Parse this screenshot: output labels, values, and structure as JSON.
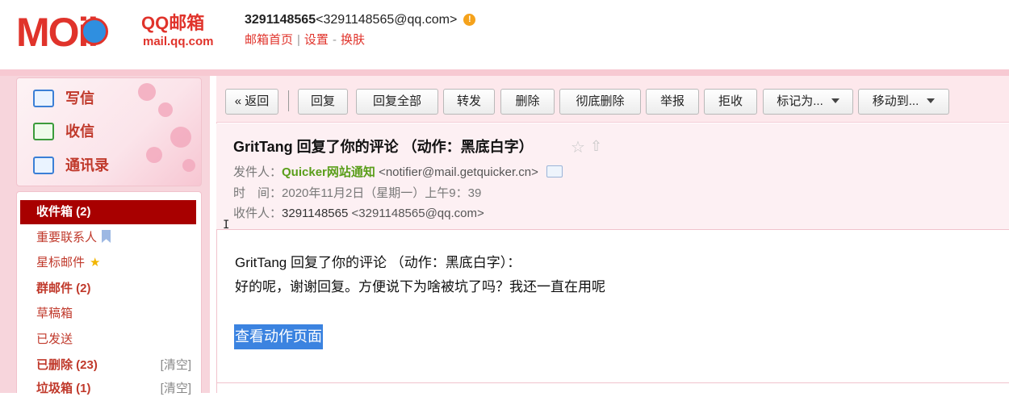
{
  "header": {
    "logo_main": "MOil",
    "logo_qq": "QQ邮箱",
    "logo_domain": "mail.qq.com",
    "user_name": "3291148565",
    "user_email": "<3291148565@qq.com>",
    "warn_glyph": "!",
    "links": [
      "邮箱首页",
      "设置",
      "换肤"
    ],
    "link_separators": [
      "|",
      "-"
    ]
  },
  "quick_actions": [
    {
      "label": "写信",
      "icon": "compose-icon"
    },
    {
      "label": "收信",
      "icon": "inbox-download-icon"
    },
    {
      "label": "通讯录",
      "icon": "contacts-icon"
    }
  ],
  "folders": [
    {
      "label": "收件箱 (2)",
      "active": true,
      "bold": true
    },
    {
      "label": "重要联系人",
      "icon": "bookmark-icon"
    },
    {
      "label": "星标邮件",
      "icon": "star-icon",
      "glyph": "★"
    },
    {
      "label": "群邮件 (2)",
      "bold": true
    },
    {
      "label": "草稿箱"
    },
    {
      "label": "已发送"
    },
    {
      "label": "已删除 (23)",
      "bold": true,
      "clear": "[清空]"
    },
    {
      "label": "垃圾箱 (1)",
      "bold": true,
      "clear": "[清空]"
    }
  ],
  "toolbar": {
    "back": "« 返回",
    "reply": "回复",
    "reply_all": "回复全部",
    "forward": "转发",
    "delete": "删除",
    "delete_permanent": "彻底删除",
    "report": "举报",
    "reject": "拒收",
    "mark_as": "标记为...",
    "move_to": "移动到..."
  },
  "mail": {
    "subject": "GritTang 回复了你的评论 （动作：黑底白字）",
    "star_glyph": "☆",
    "share_glyph": "⇧",
    "from_label": "发件人：",
    "from_name": "Quicker网站通知",
    "from_addr": "<notifier@mail.getquicker.cn>",
    "time_label": "时　间：",
    "time_value": "2020年11月2日（星期一）上午9：39",
    "to_label": "收件人：",
    "to_name": "3291148565",
    "to_addr": "<3291148565@qq.com>",
    "body_line1": "GritTang 回复了你的评论 （动作：黑底白字）：",
    "body_line2": "好的呢，谢谢回复。方便说下为啥被坑了吗？我还一直在用呢",
    "action_link": "查看动作页面"
  },
  "colors": {
    "brand_red": "#e0332b",
    "active_folder": "#a80000",
    "toolbar_bg": "#fde8ec",
    "sender_green": "#5a9e1a",
    "link_highlight": "#3b83e0"
  }
}
